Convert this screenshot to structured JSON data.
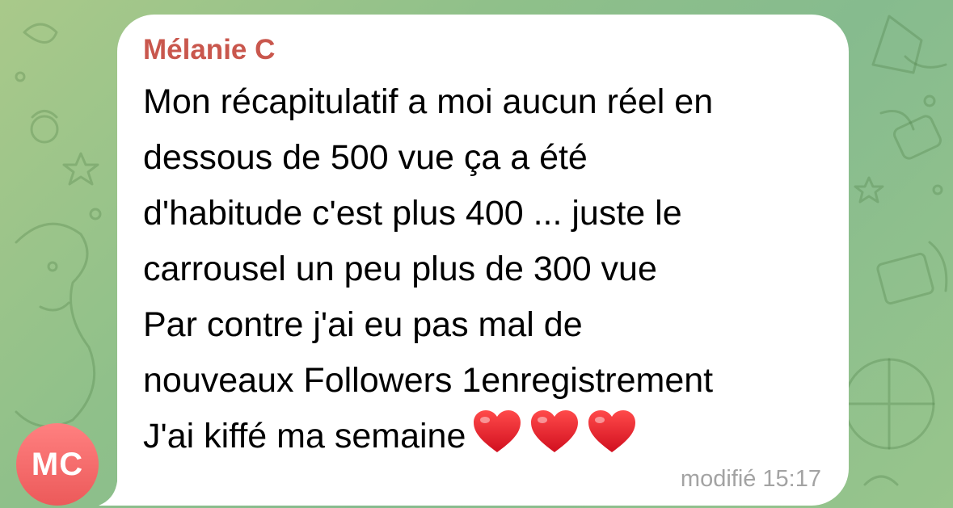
{
  "chat": {
    "avatar_initials": "MC",
    "avatar_color": "#ef6464",
    "sender_name": "Mélanie C",
    "sender_color": "#c9574d",
    "message_lines": [
      "Mon récapitulatif a moi aucun réel en",
      "dessous de 500 vue ça a été",
      "d'habitude c'est plus 400 ... juste le",
      "carrousel un peu plus de 300 vue",
      "Par contre j'ai eu pas mal de",
      "nouveaux Followers 1enregistrement",
      "J'ai kiffé ma semaine"
    ],
    "emoji": [
      "red-heart-icon",
      "red-heart-icon",
      "red-heart-icon"
    ],
    "edited_label": "modifié",
    "time": "15:17"
  },
  "theme": {
    "bubble_background": "#ffffff",
    "wallpaper": "#8fc08a"
  }
}
